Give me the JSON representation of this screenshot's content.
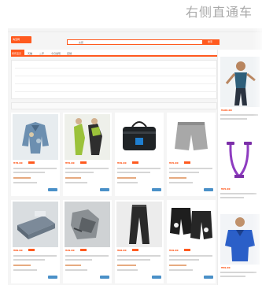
{
  "headline": "右侧直通车",
  "site": {
    "logo_text": "淘宝网",
    "search_value": "女装",
    "search_button": "搜索",
    "nav_tabs": [
      "所有宝贝",
      "天猫",
      "二手",
      "今日发现",
      "店铺"
    ]
  },
  "colors": {
    "accent": "#ff5a1f",
    "price": "#ff4400",
    "cart_button": "#4a90c8",
    "headline": "#a9a9a9"
  },
  "products": [
    {
      "price": "¥78.00",
      "icon": "jacket-product"
    },
    {
      "price": "¥55.00",
      "icon": "tracksuit-product"
    },
    {
      "price": "¥39.00",
      "icon": "bag-product"
    },
    {
      "price": "¥45.00",
      "icon": "shorts-product"
    },
    {
      "price": "¥89.00",
      "icon": "bedding-product"
    },
    {
      "price": "¥29.00",
      "icon": "clothes-product"
    },
    {
      "price": "¥68.00",
      "icon": "pants-product"
    },
    {
      "price": "¥49.00",
      "icon": "shorts-pair-product"
    }
  ],
  "sidebar_ads": [
    {
      "price": "¥168.00",
      "icon": "fitness-woman-ad"
    },
    {
      "price": "¥25.00",
      "icon": "resistance-band-ad"
    },
    {
      "price": "¥59.00",
      "icon": "sports-shirt-ad"
    }
  ]
}
